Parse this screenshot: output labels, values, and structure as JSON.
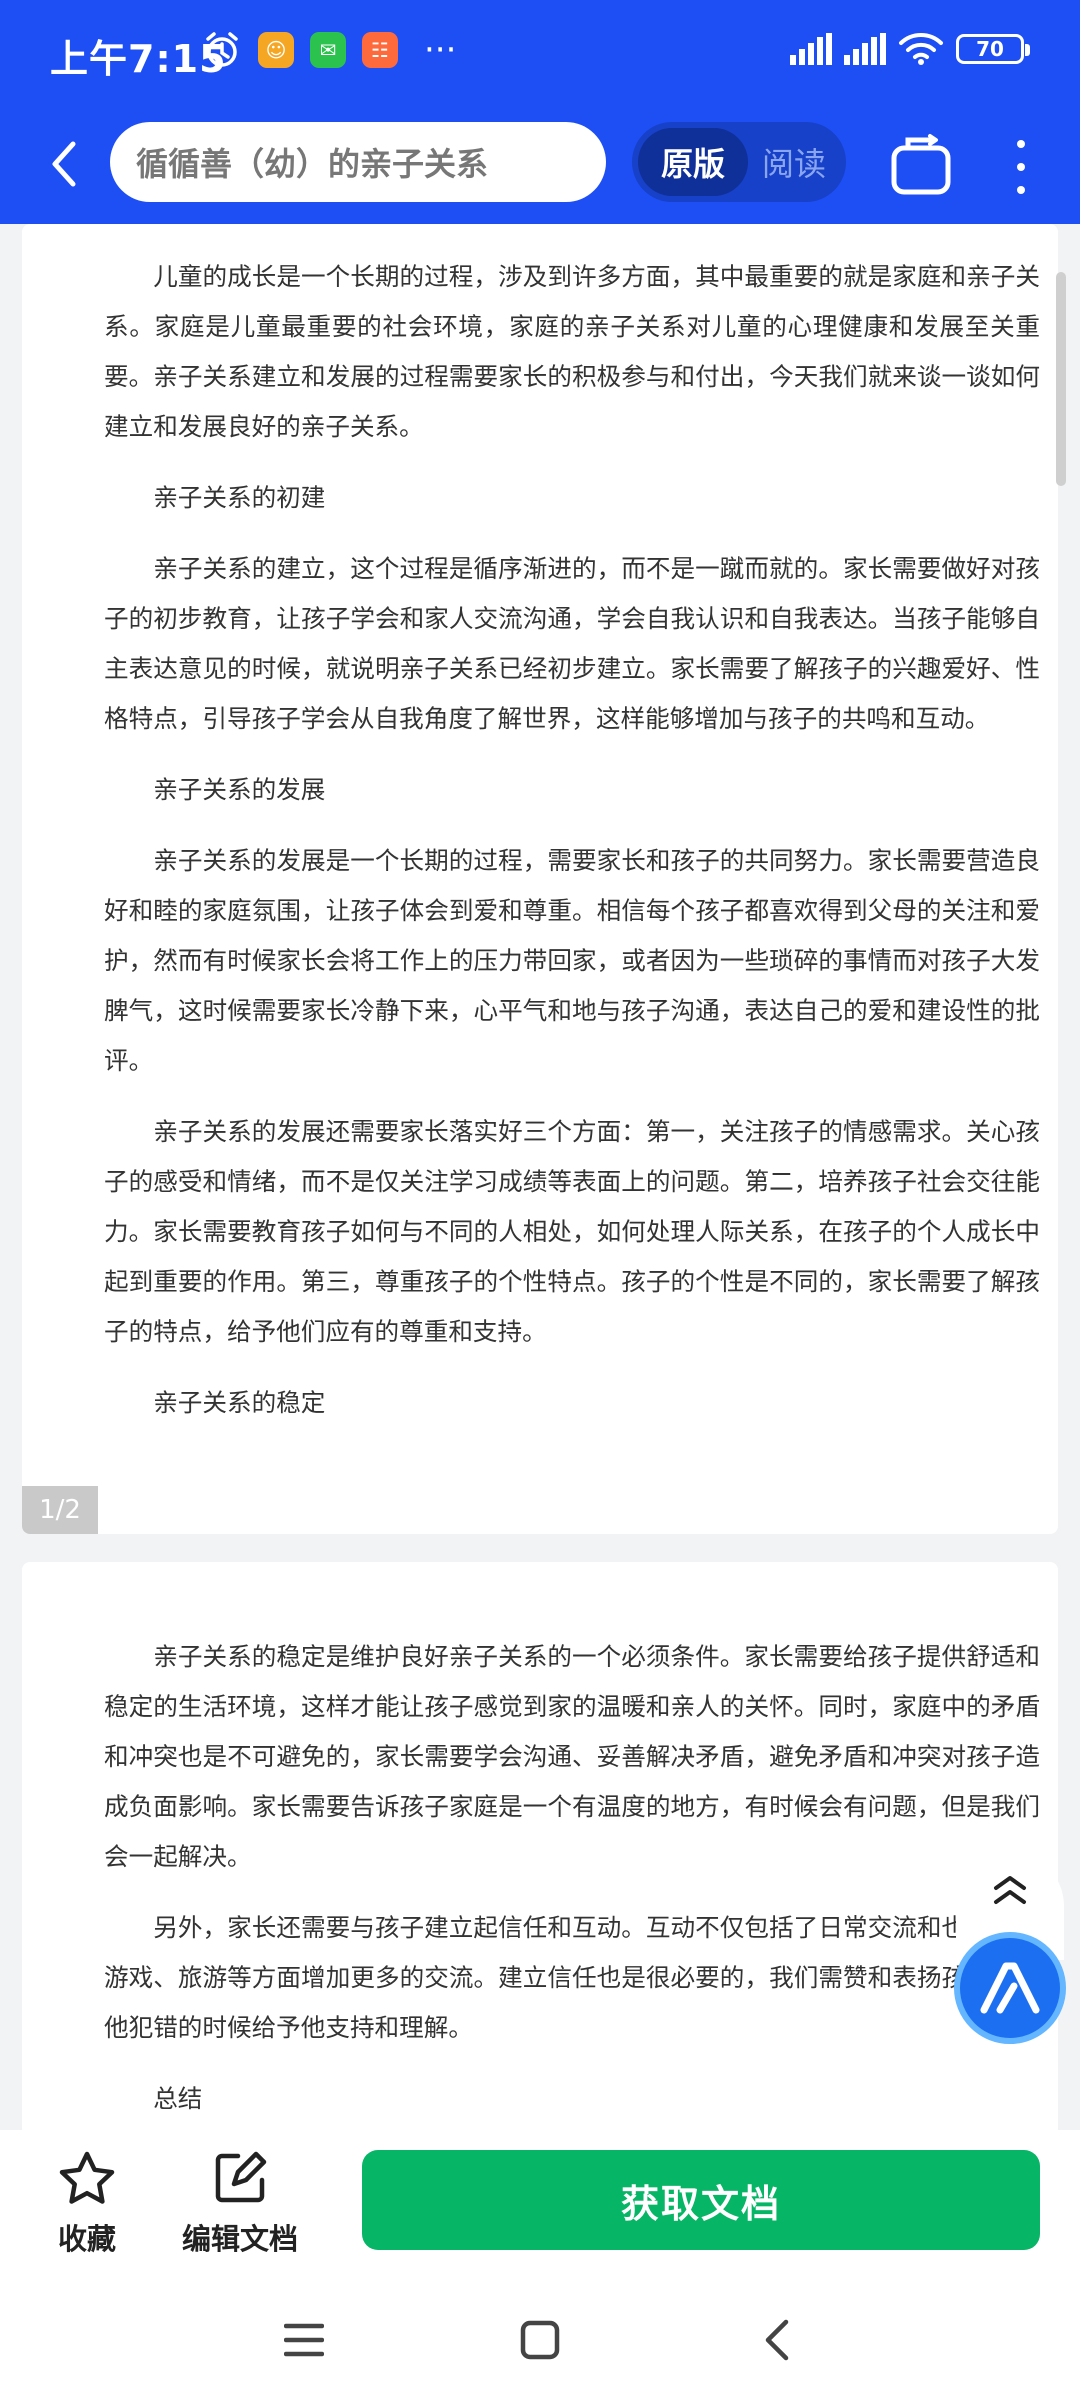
{
  "status_bar": {
    "time": "上午7:15",
    "battery": "70",
    "more": "···"
  },
  "toolbar": {
    "search_text": "循循善（幼）的亲子关系",
    "mode_original": "原版",
    "mode_reading": "阅读"
  },
  "document": {
    "page1_paragraphs": [
      "儿童的成长是一个长期的过程，涉及到许多方面，其中最重要的就是家庭和亲子关系。家庭是儿童最重要的社会环境，家庭的亲子关系对儿童的心理健康和发展至关重要。亲子关系建立和发展的过程需要家长的积极参与和付出，今天我们就来谈一谈如何建立和发展良好的亲子关系。",
      "亲子关系的初建",
      "亲子关系的建立，这个过程是循序渐进的，而不是一蹴而就的。家长需要做好对孩子的初步教育，让孩子学会和家人交流沟通，学会自我认识和自我表达。当孩子能够自主表达意见的时候，就说明亲子关系已经初步建立。家长需要了解孩子的兴趣爱好、性格特点，引导孩子学会从自我角度了解世界，这样能够增加与孩子的共鸣和互动。",
      "亲子关系的发展",
      "亲子关系的发展是一个长期的过程，需要家长和孩子的共同努力。家长需要营造良好和睦的家庭氛围，让孩子体会到爱和尊重。相信每个孩子都喜欢得到父母的关注和爱护，然而有时候家长会将工作上的压力带回家，或者因为一些琐碎的事情而对孩子大发脾气，这时候需要家长冷静下来，心平气和地与孩子沟通，表达自己的爱和建设性的批评。",
      "亲子关系的发展还需要家长落实好三个方面：第一，关注孩子的情感需求。关心孩子的感受和情绪，而不是仅关注学习成绩等表面上的问题。第二，培养孩子社会交往能力。家长需要教育孩子如何与不同的人相处，如何处理人际关系，在孩子的个人成长中起到重要的作用。第三，尊重孩子的个性特点。孩子的个性是不同的，家长需要了解孩子的特点，给予他们应有的尊重和支持。",
      "亲子关系的稳定"
    ],
    "page1_number": "1/2",
    "page2_paragraphs": [
      "亲子关系的稳定是维护良好亲子关系的一个必须条件。家长需要给孩子提供舒适和稳定的生活环境，这样才能让孩子感觉到家的温暖和亲人的关怀。同时，家庭中的矛盾和冲突也是不可避免的，家长需要学会沟通、妥善解决矛盾，避免矛盾和冲突对孩子造成负面影响。家长需要告诉孩子家庭是一个有温度的地方，有时候会有问题，但是我们会一起解决。",
      "另外，家长还需要与孩子建立起信任和互动。互动不仅包括了日常交流和也可以在游戏、旅游等方面增加更多的交流。建立信任也是很必要的，我们需赞和表扬孩子，在他犯错的时候给予他支持和理解。",
      "总结"
    ]
  },
  "actions": {
    "favorite_label": "收藏",
    "edit_label": "编辑文档",
    "get_doc_label": "获取文档"
  },
  "colors": {
    "header_bg": "#1d4ff5",
    "primary_green": "#07b566"
  }
}
